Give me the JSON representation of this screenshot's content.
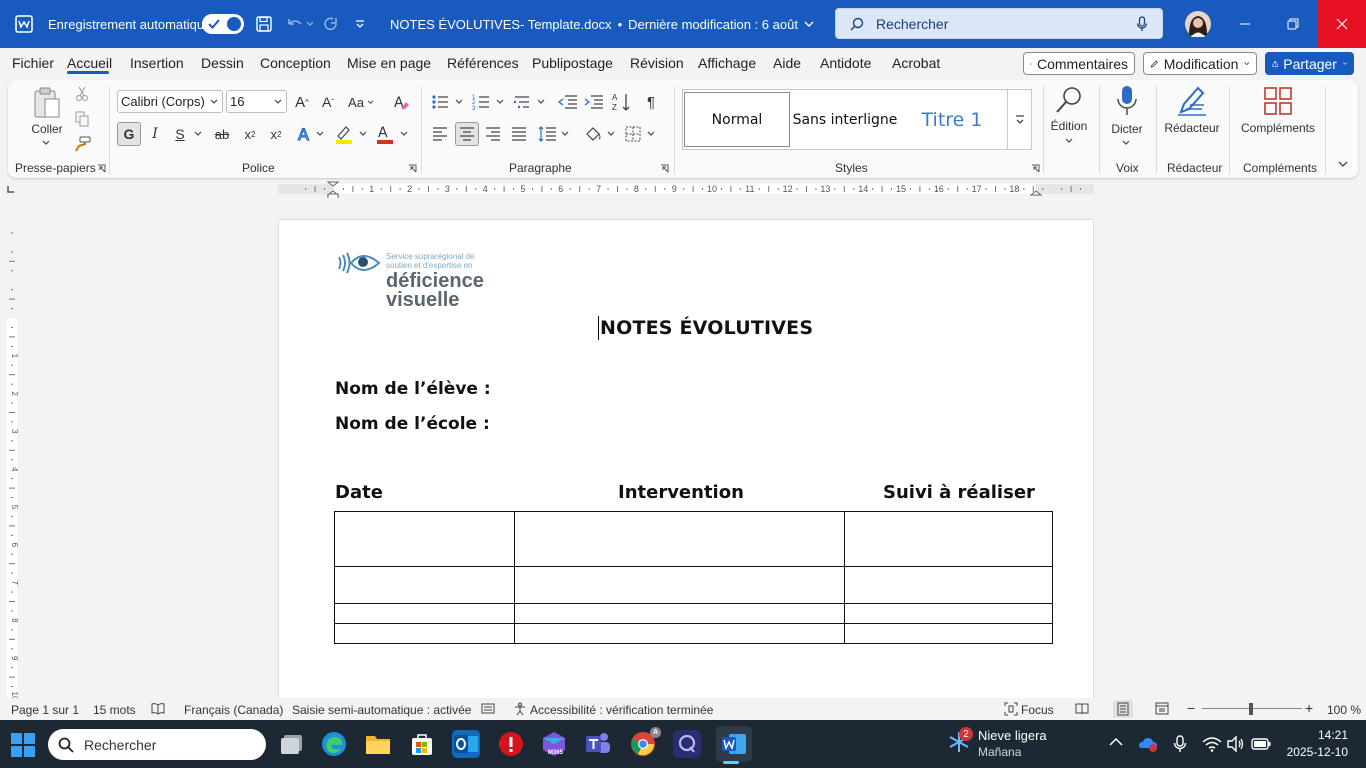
{
  "titlebar": {
    "autosave_label": "Enregistrement automatique",
    "doc_title": "NOTES ÉVOLUTIVES- Template.docx",
    "last_modified": "Dernière modification : 6 août",
    "search_placeholder": "Rechercher",
    "accent": "#185abd"
  },
  "menu": {
    "items": [
      "Fichier",
      "Accueil",
      "Insertion",
      "Dessin",
      "Conception",
      "Mise en page",
      "Références",
      "Publipostage",
      "Révision",
      "Affichage",
      "Aide",
      "Antidote",
      "Acrobat"
    ],
    "active": "Accueil",
    "comments_label": "Commentaires",
    "mode_label": "Modification",
    "share_label": "Partager"
  },
  "ribbon": {
    "paste_label": "Coller",
    "font_name": "Calibri (Corps)",
    "font_size": "16",
    "styles": [
      "Normal",
      "Sans interligne",
      "Titre 1"
    ],
    "editing_label": "Édition",
    "dictate_label": "Dicter",
    "editor_label": "Rédacteur",
    "addins_label": "Compléments",
    "groups": {
      "clipboard": "Presse-papiers",
      "font": "Police",
      "paragraph": "Paragraphe",
      "styles": "Styles",
      "voice": "Voix",
      "editor": "Rédacteur",
      "addins": "Compléments"
    },
    "bold_label": "G",
    "italic_label": "I",
    "underline_label": "S"
  },
  "ruler_numbers": [
    "1",
    "2",
    "3",
    "4",
    "5",
    "6",
    "7",
    "8",
    "9",
    "10",
    "11",
    "12",
    "13",
    "14",
    "15",
    "16",
    "17",
    "18"
  ],
  "vruler_numbers": [
    "1",
    "2",
    "3",
    "4",
    "5",
    "6",
    "7",
    "8",
    "9",
    "10"
  ],
  "document": {
    "logo_line1": "Service suprarégional de",
    "logo_line2": "soutien et d'expertise en",
    "logo_word1": "déficience",
    "logo_word2": "visuelle",
    "title": "NOTES ÉVOLUTIVES",
    "field_student": "Nom de l’élève :",
    "field_school": "Nom de l’école :",
    "col_date": "Date",
    "col_intervention": "Intervention",
    "col_followup": "Suivi à réaliser"
  },
  "status": {
    "page": "Page 1 sur 1",
    "words": "15 mots",
    "language": "Français (Canada)",
    "autocomplete": "Saisie semi-automatique : activée",
    "accessibility": "Accessibilité : vérification terminée",
    "focus": "Focus",
    "zoom": "100 %",
    "zoom_level": 1.0
  },
  "taskbar": {
    "search_placeholder": "Rechercher",
    "weather_title": "Nieve ligera",
    "weather_sub": "Mañana",
    "weather_badge": "2",
    "time": "14:21",
    "date": "2025-12-10",
    "m365_label": "M365"
  }
}
